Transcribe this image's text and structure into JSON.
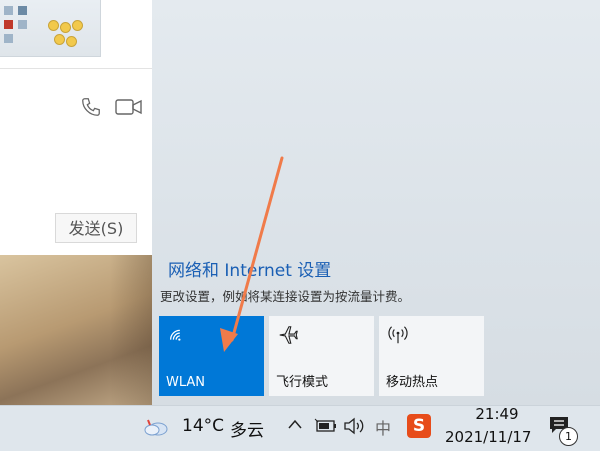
{
  "chat": {
    "send_label": "发送(S)"
  },
  "action_center": {
    "settings_link": "网络和 Internet 设置",
    "settings_desc": "更改设置，例如将某连接设置为按流量计费。",
    "tiles": [
      {
        "label": "WLAN",
        "icon": "wifi-icon",
        "active": true,
        "color": "#0078d7"
      },
      {
        "label": "飞行模式",
        "icon": "airplane-icon",
        "active": false
      },
      {
        "label": "移动热点",
        "icon": "hotspot-icon",
        "active": false
      }
    ]
  },
  "taskbar": {
    "temperature": "14°C",
    "condition": "多云",
    "ime": "中",
    "sogou": "S",
    "time": "21:49",
    "date": "2021/11/17",
    "notification_count": "1"
  },
  "annotation": {
    "arrow_color": "#f07b4a"
  }
}
